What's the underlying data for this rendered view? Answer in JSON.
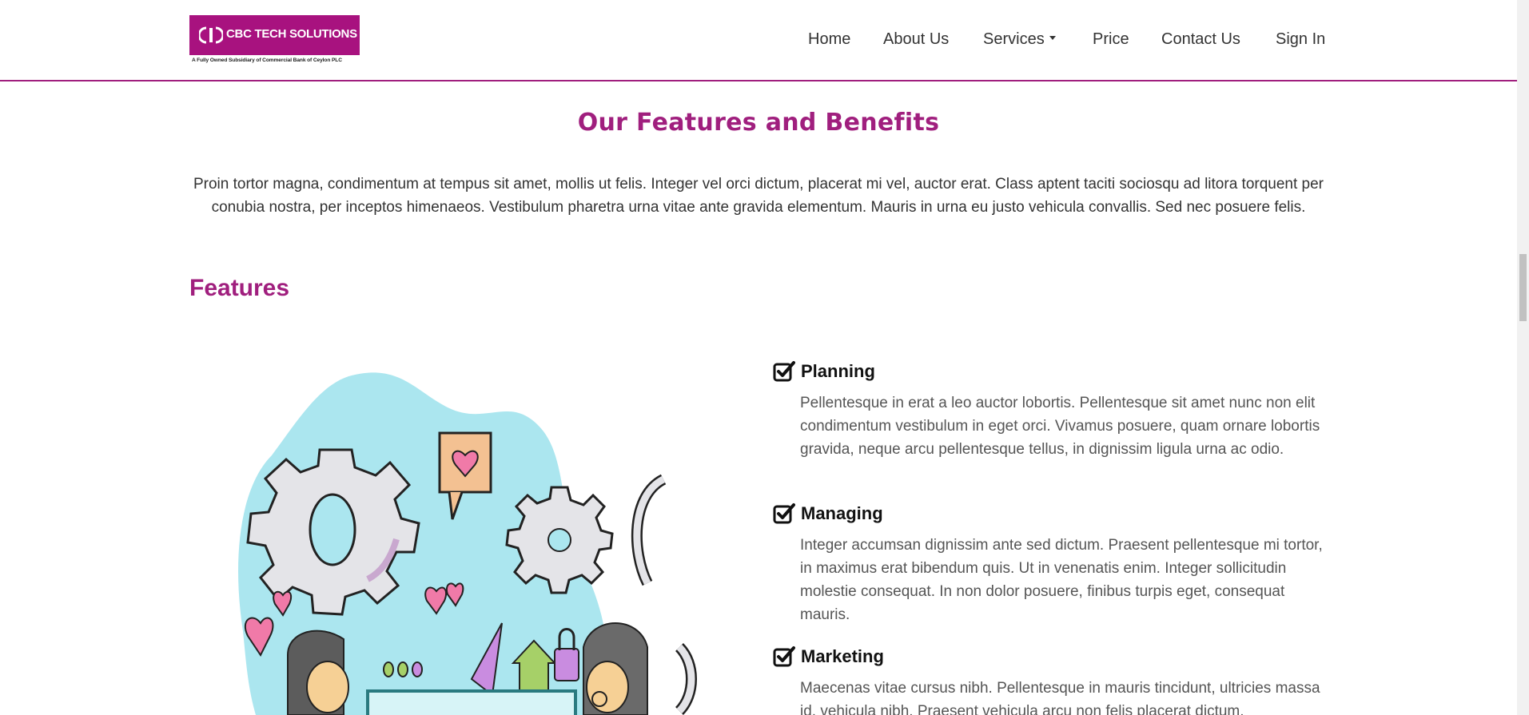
{
  "header": {
    "logo": {
      "name": "CBC TECH SOLUTIONS",
      "tagline": "A Fully Owned Subsidiary of Commercial Bank of Ceylon PLC"
    },
    "nav": {
      "home": "Home",
      "about": "About Us",
      "services": "Services",
      "price": "Price",
      "contact": "Contact Us",
      "signin": "Sign In"
    }
  },
  "section": {
    "title": "Our Features and Benefits",
    "intro": "Proin tortor magna, condimentum at tempus sit amet, mollis ut felis. Integer vel orci dictum, placerat mi vel, auctor erat. Class aptent taciti sociosqu ad litora torquent per conubia nostra, per inceptos himenaeos. Vestibulum pharetra urna vitae ante gravida elementum. Mauris in urna eu justo vehicula convallis. Sed nec posuere felis.",
    "features_heading": "Features"
  },
  "features": [
    {
      "title": "Planning",
      "description": "Pellentesque in erat a leo auctor lobortis. Pellentesque sit amet nunc non elit condimentum vestibulum in eget orci. Vivamus posuere, quam ornare lobortis gravida, neque arcu pellentesque tellus, in dignissim ligula urna ac odio."
    },
    {
      "title": "Managing",
      "description": "Integer accumsan dignissim ante sed dictum. Praesent pellentesque mi tortor, in maximus erat bibendum quis. Ut in venenatis enim. Integer sollicitudin molestie consequat. In non dolor posuere, finibus turpis eget, consequat mauris."
    },
    {
      "title": "Marketing",
      "description": "Maecenas vitae cursus nibh. Pellentesque in mauris tincidunt, ultricies massa id, vehicula nibh. Praesent vehicula arcu non felis placerat dictum."
    }
  ],
  "colors": {
    "brand": "#a8127f",
    "heading_accent": "#a01f7e",
    "illustration_blob": "#abe6ef"
  },
  "icons": {
    "feature_check": "check-square-icon",
    "services_dropdown": "caret-down-icon"
  }
}
